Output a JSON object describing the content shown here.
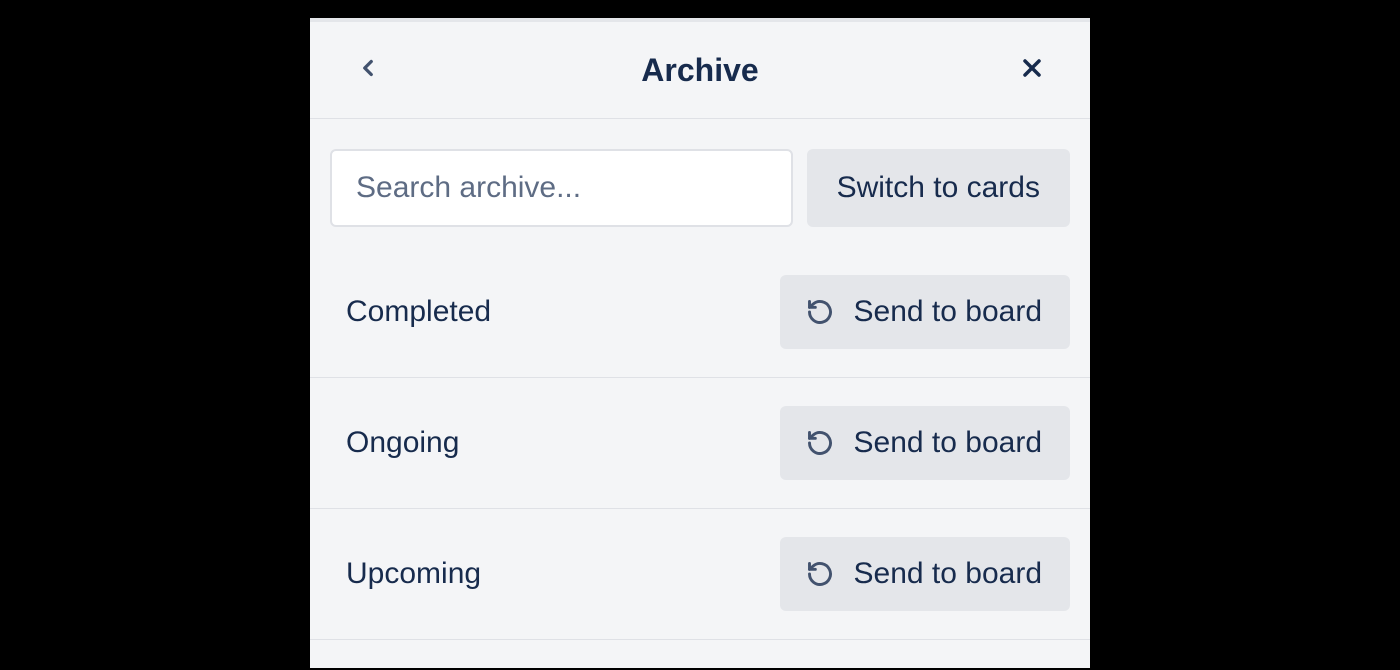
{
  "header": {
    "title": "Archive"
  },
  "search": {
    "placeholder": "Search archive...",
    "value": ""
  },
  "switch_button": {
    "label": "Switch to cards"
  },
  "send_button_label": "Send to board",
  "items": [
    {
      "name": "Completed"
    },
    {
      "name": "Ongoing"
    },
    {
      "name": "Upcoming"
    }
  ]
}
